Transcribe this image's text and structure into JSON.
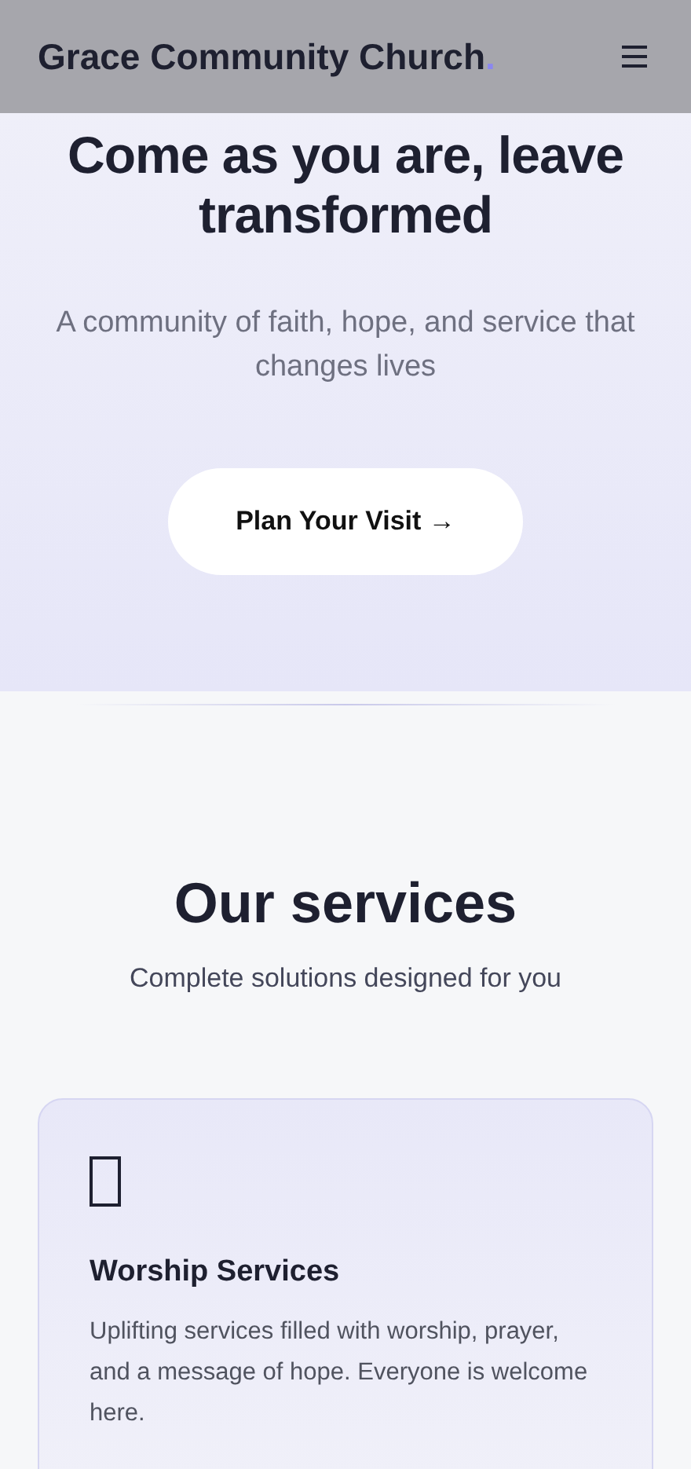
{
  "header": {
    "brand": "Grace Community Church",
    "brand_accent": "."
  },
  "hero": {
    "title": "Come as you are, leave transformed",
    "subtitle": "A community of faith, hope, and service that changes lives",
    "button": "Plan Your Visit →"
  },
  "services": {
    "title": "Our services",
    "subtitle": "Complete solutions designed for you",
    "cards": [
      {
        "title": "Worship Services",
        "description": "Uplifting services filled with worship, prayer, and a message of hope. Everyone is welcome here."
      }
    ]
  }
}
